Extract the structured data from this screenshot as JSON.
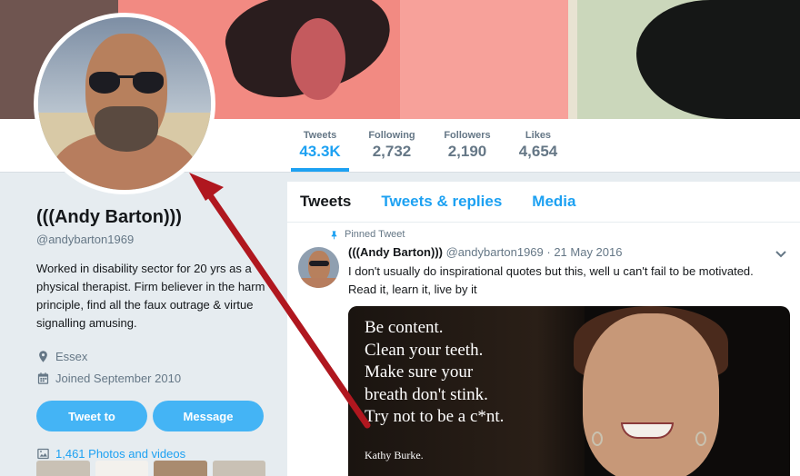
{
  "header": {
    "stats": [
      {
        "label": "Tweets",
        "value": "43.3K",
        "active": true
      },
      {
        "label": "Following",
        "value": "2,732",
        "active": false
      },
      {
        "label": "Followers",
        "value": "2,190",
        "active": false
      },
      {
        "label": "Likes",
        "value": "4,654",
        "active": false
      }
    ]
  },
  "profile": {
    "name": "(((Andy Barton)))",
    "handle": "@andybarton1969",
    "bio": "Worked in disability sector for 20 yrs as a physical therapist. Firm believer in the harm principle, find all the faux outrage & virtue signalling amusing.",
    "location": "Essex",
    "joined": "Joined September 2010",
    "tweet_to_label": "Tweet to",
    "message_label": "Message",
    "photos_label": "1,461 Photos and videos",
    "location_icon": "location-pin-icon",
    "calendar_icon": "calendar-icon",
    "photos_icon": "image-icon"
  },
  "timeline": {
    "tabs": [
      "Tweets",
      "Tweets & replies",
      "Media"
    ],
    "pinned_label": "Pinned Tweet",
    "tweet": {
      "name": "(((Andy Barton)))",
      "handle_date": " @andybarton1969 · 21 May 2016",
      "text_line1": "I don't usually do inspirational quotes but this, well u can't fail to be motivated.",
      "text_line2": "Read it, learn it, live by it",
      "image_quote": "Be content.\nClean your teeth.\nMake sure your\nbreath don't stink.\nTry not to be a c*nt.",
      "image_author": "Kathy Burke."
    }
  },
  "colors": {
    "accent": "#1da1f2",
    "button": "#44b4f5",
    "arrow": "#b0171f"
  }
}
